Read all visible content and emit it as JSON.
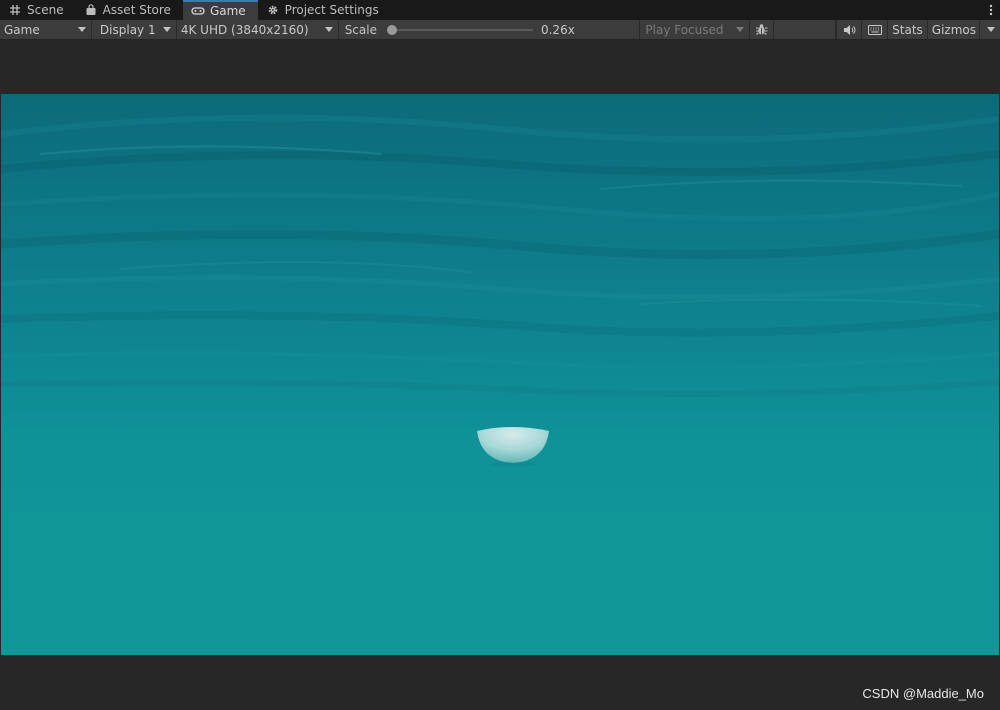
{
  "tabs": [
    {
      "label": "Scene",
      "icon": "grid-icon",
      "active": false
    },
    {
      "label": "Asset Store",
      "icon": "store-bag-icon",
      "active": false
    },
    {
      "label": "Game",
      "icon": "gamepad-icon",
      "active": true
    },
    {
      "label": "Project Settings",
      "icon": "gear-icon",
      "active": false
    }
  ],
  "toolbar": {
    "view_mode": "Game",
    "display": "Display 1",
    "resolution": "4K UHD (3840x2160)",
    "scale_label": "Scale",
    "scale_value": "0.26x",
    "scale_fraction": 0.0,
    "play_mode": "Play Focused",
    "stats_label": "Stats",
    "gizmos_label": "Gizmos"
  },
  "colors": {
    "accent": "#3a79bb",
    "water_top": "#0c6a7a",
    "water_bottom": "#109799",
    "panel": "#3c3c3c",
    "background": "#282828"
  },
  "watermark": "CSDN @Maddie_Mo"
}
